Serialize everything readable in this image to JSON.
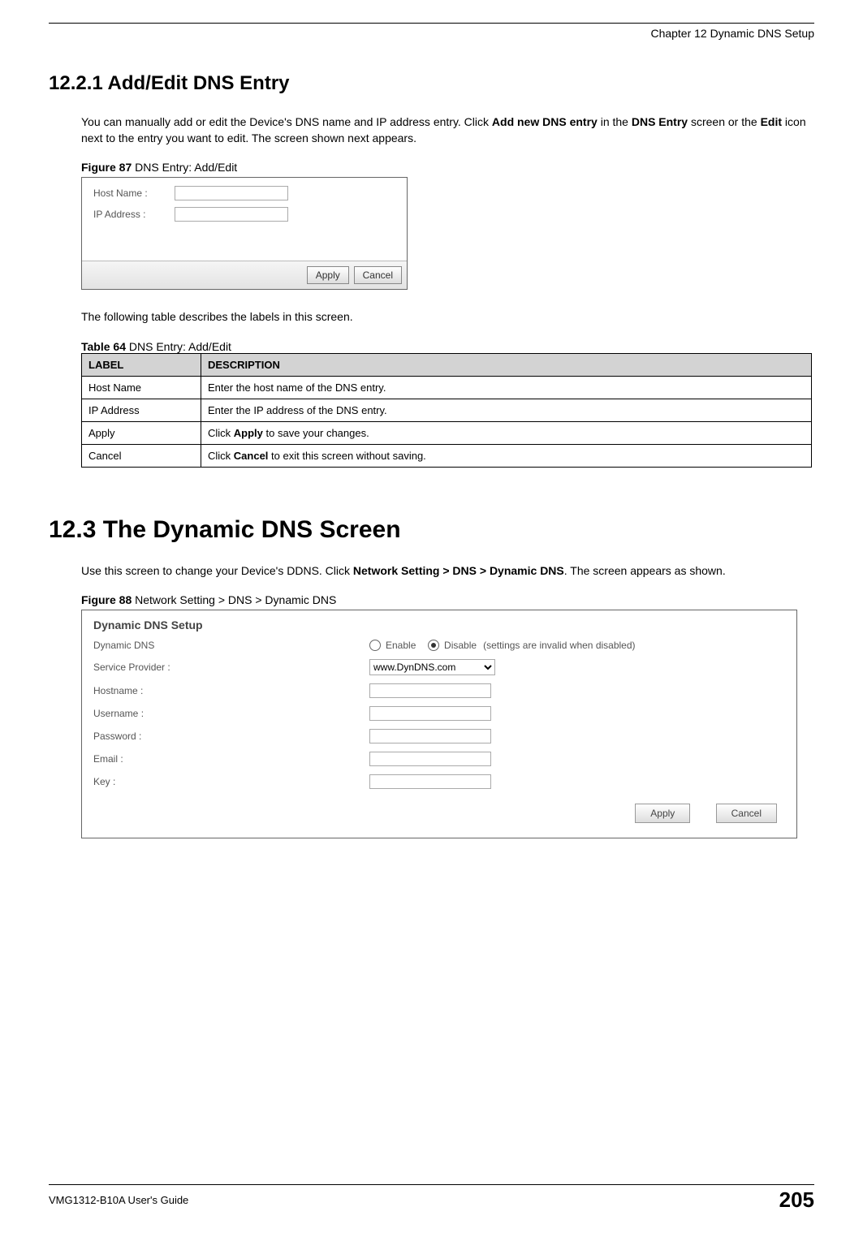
{
  "header": {
    "chapter": "Chapter 12 Dynamic DNS Setup"
  },
  "section_1221": {
    "number_title": "12.2.1  Add/Edit DNS Entry",
    "para_prefix": "You can manually add or edit the Device's DNS name and IP address entry. Click ",
    "bold1": "Add new DNS entry",
    "para_mid1": " in the ",
    "bold2": "DNS Entry",
    "para_mid2": " screen or the ",
    "bold3": "Edit",
    "para_suffix": " icon next to the entry you want to edit. The screen shown next appears."
  },
  "figure87": {
    "caption_bold": "Figure 87",
    "caption_rest": "   DNS Entry: Add/Edit",
    "hostname_label": "Host Name :",
    "ipaddress_label": "IP Address :",
    "apply": "Apply",
    "cancel": "Cancel"
  },
  "table_intro": "The following table describes the labels in this screen.",
  "table64": {
    "caption_bold": "Table 64",
    "caption_rest": "   DNS Entry: Add/Edit",
    "head_label": "LABEL",
    "head_desc": "DESCRIPTION",
    "rows": [
      {
        "label": "Host Name",
        "desc_pre": "Enter the host name of the DNS entry.",
        "bold": "",
        "desc_post": ""
      },
      {
        "label": "IP Address",
        "desc_pre": "Enter the IP address of the DNS entry.",
        "bold": "",
        "desc_post": ""
      },
      {
        "label": "Apply",
        "desc_pre": "Click ",
        "bold": "Apply",
        "desc_post": " to save your changes."
      },
      {
        "label": "Cancel",
        "desc_pre": "Click ",
        "bold": "Cancel",
        "desc_post": " to exit this screen without saving."
      }
    ]
  },
  "section_123": {
    "number_title": "12.3  The Dynamic DNS Screen",
    "para_prefix": "Use this screen to change your Device's DDNS. Click ",
    "bold1": "Network Setting > DNS > Dynamic DNS",
    "para_suffix": ". The screen appears as shown."
  },
  "figure88": {
    "caption_bold": "Figure 88",
    "caption_rest": "   Network Setting > DNS > Dynamic DNS",
    "panel_title": "Dynamic DNS Setup",
    "dynamicdns_label": "Dynamic DNS",
    "enable": "Enable",
    "disable": "Disable",
    "disable_hint": "(settings are invalid when disabled)",
    "service_provider_label": "Service Provider :",
    "service_provider_value": "www.DynDNS.com",
    "hostname_label": "Hostname :",
    "username_label": "Username :",
    "password_label": "Password :",
    "email_label": "Email :",
    "key_label": "Key :",
    "apply": "Apply",
    "cancel": "Cancel"
  },
  "footer": {
    "guide": "VMG1312-B10A User's Guide",
    "page": "205"
  }
}
